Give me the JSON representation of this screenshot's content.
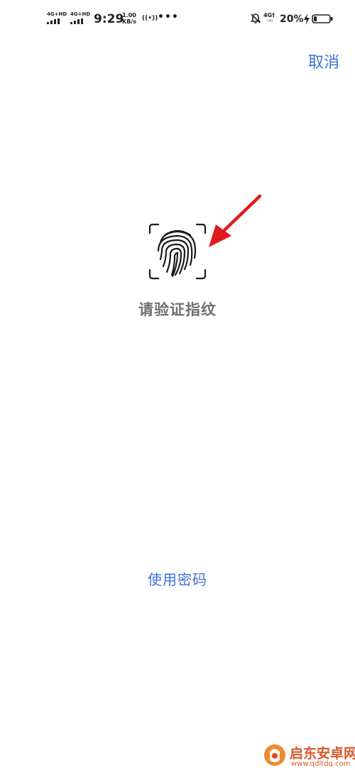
{
  "status_bar": {
    "sim1_network": "4G+HD",
    "sim2_network": "4G+HD",
    "time": "9:29",
    "speed_value": "1.00",
    "speed_unit": "KB/s",
    "hotspot_symbol": "((•))",
    "more_symbol": "•••",
    "network_type": "4G†",
    "network_sub": "HD",
    "battery_percent": "20%",
    "battery_level": 0.2,
    "icons": [
      "signal-icon",
      "hotspot-icon",
      "mute-bell-icon",
      "charging-icon",
      "battery-icon"
    ]
  },
  "header": {
    "cancel_label": "取消"
  },
  "main": {
    "fingerprint_icon": "fingerprint-icon",
    "prompt": "请验证指纹",
    "annotation_icon": "red-arrow-icon"
  },
  "footer": {
    "use_password_label": "使用密码"
  },
  "watermark": {
    "title": "启东安卓网",
    "url": "www.qdltdq.com"
  },
  "colors": {
    "accent": "#3e72d4",
    "prompt_text": "#707070",
    "arrow": "#e01b1b",
    "watermark": "#d8582a"
  }
}
